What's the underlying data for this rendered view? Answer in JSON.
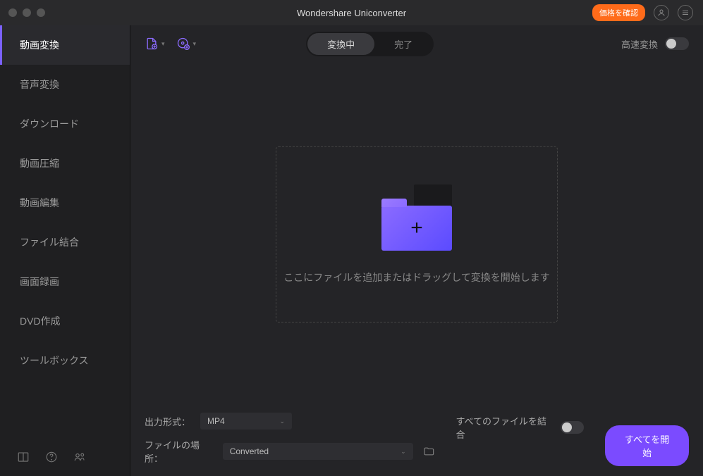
{
  "app_title": "Wondershare Uniconverter",
  "price_button": "価格を確認",
  "sidebar": {
    "items": [
      "動画変換",
      "音声変換",
      "ダウンロード",
      "動画圧縮",
      "動画編集",
      "ファイル結合",
      "画面録画",
      "DVD作成",
      "ツールボックス"
    ],
    "active_index": 0
  },
  "tabs": {
    "converting": "変換中",
    "done": "完了",
    "active": 0
  },
  "fast_convert_label": "高速変換",
  "drop_text": "ここにファイルを追加またはドラッグして変換を開始します",
  "footer": {
    "format_label": "出力形式：",
    "format_value": "MP4",
    "location_label": "ファイルの場所：",
    "location_value": "Converted",
    "merge_label": "すべてのファイルを結合",
    "start_button": "すべてを開始"
  }
}
